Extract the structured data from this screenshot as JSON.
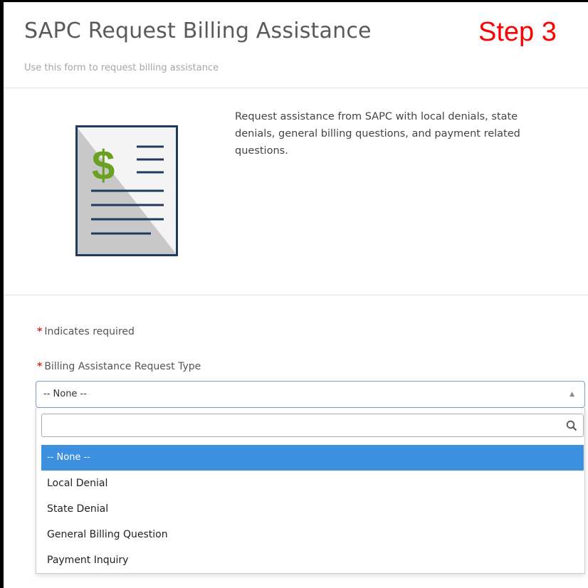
{
  "header": {
    "title": "SAPC Request Billing Assistance",
    "step_label": "Step 3",
    "subtitle": "Use this form to request billing assistance"
  },
  "intro": {
    "icon": "billing-document-dollar-icon",
    "description": "Request assistance from SAPC with local denials, state denials, general billing questions, and payment related questions."
  },
  "form": {
    "required_note": "Indicates required",
    "request_type": {
      "label": "Billing Assistance Request Type",
      "selected_value": "-- None --",
      "search_placeholder": "",
      "options": [
        "-- None --",
        "Local Denial",
        "State Denial",
        "General Billing Question",
        "Payment Inquiry"
      ],
      "highlighted_index": 0
    }
  },
  "colors": {
    "step_label": "#ff0000",
    "required_asterisk": "#c0392b",
    "highlight": "#3d8fe0",
    "icon_dollar": "#6aa121",
    "icon_lines": "#1f3a5c"
  }
}
